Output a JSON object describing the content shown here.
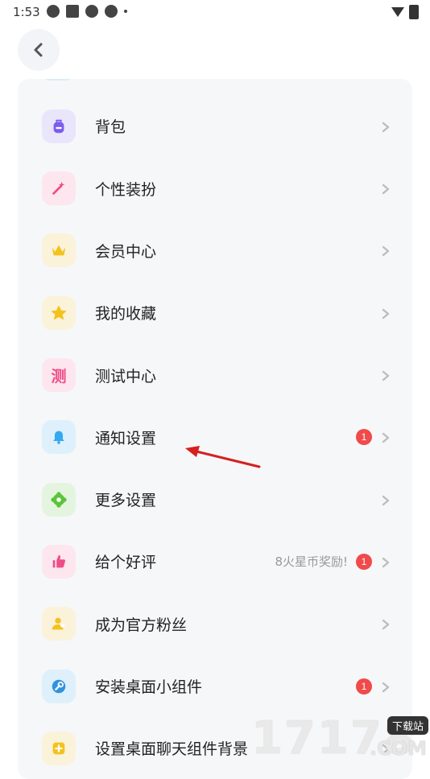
{
  "status_bar": {
    "time": "1:53"
  },
  "menu": {
    "items": [
      {
        "label": "背包",
        "icon": "backpack-icon",
        "bg": "#e9e6fb",
        "fg": "#7a5cf0"
      },
      {
        "label": "个性装扮",
        "icon": "magic-wand-icon",
        "bg": "#fde6ee",
        "fg": "#ee4d87"
      },
      {
        "label": "会员中心",
        "icon": "crown-icon",
        "bg": "#fbf2da",
        "fg": "#f4c21d"
      },
      {
        "label": "我的收藏",
        "icon": "star-icon",
        "bg": "#fbf2da",
        "fg": "#f4c21d"
      },
      {
        "label": "测试中心",
        "icon": "test-char-icon",
        "glyph": "测",
        "bg": "#fde6ee",
        "fg": "#ee4d87"
      },
      {
        "label": "通知设置",
        "icon": "bell-icon",
        "bg": "#def0fb",
        "fg": "#34a9f0",
        "badge": "1"
      },
      {
        "label": "更多设置",
        "icon": "gear-icon",
        "bg": "#e4f5df",
        "fg": "#5ac43a"
      },
      {
        "label": "给个好评",
        "icon": "thumbs-up-icon",
        "bg": "#fde6ee",
        "fg": "#ee4d87",
        "badge": "1",
        "reward": "8火星币奖励!"
      },
      {
        "label": "成为官方粉丝",
        "icon": "fan-user-icon",
        "bg": "#fbf2da",
        "fg": "#f4c21d"
      },
      {
        "label": "安装桌面小组件",
        "icon": "wrench-icon",
        "bg": "#def0fb",
        "fg": "#2f93e0",
        "badge": "1"
      },
      {
        "label": "设置桌面聊天组件背景",
        "icon": "widget-bg-icon",
        "bg": "#fbf2da",
        "fg": "#f4c21d"
      }
    ]
  },
  "watermark": {
    "number": "17178",
    "tag": "下载站",
    "domain": ".COM"
  },
  "colors": {
    "badge": "#f04a4a",
    "arrow": "#d62020"
  }
}
